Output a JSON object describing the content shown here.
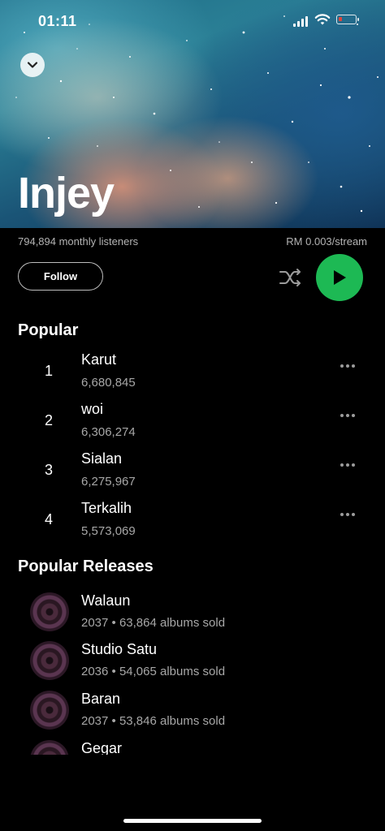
{
  "status_bar": {
    "time": "01:11"
  },
  "header": {
    "artist_name": "Injey"
  },
  "meta": {
    "monthly_listeners": "794,894 monthly listeners",
    "rate": "RM 0.003/stream"
  },
  "actions": {
    "follow_label": "Follow"
  },
  "popular": {
    "heading": "Popular",
    "tracks": [
      {
        "rank": "1",
        "title": "Karut",
        "plays": "6,680,845"
      },
      {
        "rank": "2",
        "title": "woi",
        "plays": "6,306,274"
      },
      {
        "rank": "3",
        "title": "Sialan",
        "plays": "6,275,967"
      },
      {
        "rank": "4",
        "title": "Terkalih",
        "plays": "5,573,069"
      }
    ]
  },
  "releases": {
    "heading": "Popular Releases",
    "items": [
      {
        "title": "Walaun",
        "sub": "2037 • 63,864 albums sold"
      },
      {
        "title": "Studio Satu",
        "sub": "2036 • 54,065 albums sold"
      },
      {
        "title": "Baran",
        "sub": "2037 • 53,846 albums sold"
      },
      {
        "title": "Gegar",
        "sub": ""
      }
    ]
  },
  "icons": {
    "collapse": "chevron-down-icon",
    "shuffle": "shuffle-icon",
    "play": "play-icon",
    "more": "more-dots-icon"
  },
  "colors": {
    "accent": "#1db954",
    "background": "#000000",
    "secondary_text": "#a7a7a7"
  }
}
